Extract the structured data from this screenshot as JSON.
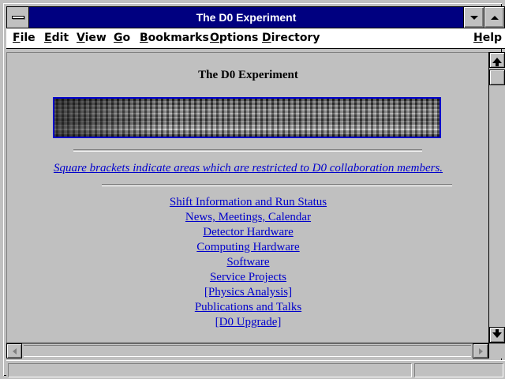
{
  "window": {
    "title": "The D0 Experiment"
  },
  "menubar": {
    "items": [
      "File",
      "Edit",
      "View",
      "Go",
      "Bookmarks",
      "Options",
      "Directory"
    ],
    "help": "Help"
  },
  "page": {
    "heading": "The D0 Experiment",
    "banner_alt": "D0 detector photograph",
    "notice": "Square brackets indicate areas which are restricted to D0 collaboration members.",
    "links": [
      "Shift Information and Run Status",
      "News, Meetings, Calendar",
      "Detector Hardware",
      "Computing Hardware",
      "Software",
      "Service Projects",
      "[Physics Analysis]",
      "Publications and Talks",
      "[D0 Upgrade]"
    ]
  },
  "statusbar": {
    "text": ""
  },
  "colors": {
    "titlebar": "#000080",
    "link": "#0000cc",
    "chrome": "#c0c0c0"
  }
}
